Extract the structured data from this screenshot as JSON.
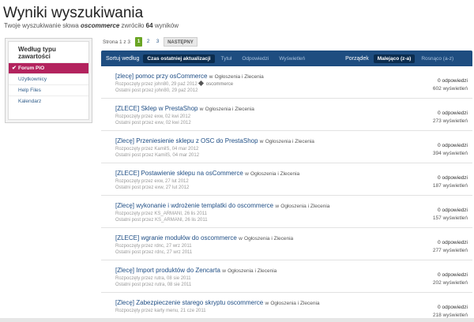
{
  "page": {
    "title": "Wyniki wyszukiwania",
    "subtitle_prefix": "Twoje wyszukiwanie słowa",
    "query": "oscommerce",
    "subtitle_mid": "zwróciło",
    "count": "64",
    "subtitle_suffix": "wyników"
  },
  "sidebar": {
    "title": "Według typu zawartości",
    "items": [
      {
        "label": "Forum PiO",
        "active": true
      },
      {
        "label": "Użytkownicy"
      },
      {
        "label": "Help Files"
      },
      {
        "label": "Kalendarz"
      }
    ]
  },
  "pagination": {
    "label": "Strona 1 z 3",
    "pages": [
      "1",
      "2",
      "3"
    ],
    "next": "NASTĘPNY"
  },
  "sortbar": {
    "sort_label": "Sortuj według",
    "options": [
      "Czas ostatniej aktualizacji",
      "Tytuł",
      "Odpowiedzi",
      "Wyświetleń"
    ],
    "order_label": "Porządek",
    "order_options": [
      "Malejąco (z-a)",
      "Rosnąco (a-z)"
    ]
  },
  "results": [
    {
      "title": "[zlecę] pomoc przy osCommerce",
      "in": "w",
      "forum": "Ogłoszenia i Zlecenia",
      "started": "Rozpoczęty przez john80, 29 paź 2012",
      "tag": "oscommerce",
      "last": "Ostatni post przez john80, 29 paź 2012",
      "replies": "0 odpowiedzi",
      "views": "602 wyświetleń"
    },
    {
      "title": "[ZLECE] Sklep w PrestaShop",
      "in": "w",
      "forum": "Ogłoszenia i Zlecenia",
      "started": "Rozpoczęty przez exw, 02 kwi 2012",
      "tag": "",
      "last": "Ostatni post przez exw, 02 kwi 2012",
      "replies": "0 odpowiedzi",
      "views": "273 wyświetleń"
    },
    {
      "title": "[Zlecę] Przeniesienie sklepu z OSC do PrestaShop",
      "in": "w",
      "forum": "Ogłoszenia i Zlecenia",
      "started": "Rozpoczęty przez KamilS, 04 mar 2012",
      "tag": "",
      "last": "Ostatni post przez KamilS, 04 mar 2012",
      "replies": "0 odpowiedzi",
      "views": "394 wyświetleń"
    },
    {
      "title": "[ZLECE] Postawienie sklepu na osCommerce",
      "in": "w",
      "forum": "Ogłoszenia i Zlecenia",
      "started": "Rozpoczęty przez exw, 27 lut 2012",
      "tag": "",
      "last": "Ostatni post przez exw, 27 lut 2012",
      "replies": "0 odpowiedzi",
      "views": "187 wyświetleń"
    },
    {
      "title": "[Zlecę] wykonanie i wdrożenie templatki do oscommerce",
      "in": "w",
      "forum": "Ogłoszenia i Zlecenia",
      "started": "Rozpoczęty przez KS_ARMANI, 26 lis 2011",
      "tag": "",
      "last": "Ostatni post przez KS_ARMANI, 26 lis 2011",
      "replies": "0 odpowiedzi",
      "views": "157 wyświetleń"
    },
    {
      "title": "[ZLECE] wgranie modułów do oscommerce",
      "in": "w",
      "forum": "Ogłoszenia i Zlecenia",
      "started": "Rozpoczęty przez rdnc, 27 wrz 2011",
      "tag": "",
      "last": "Ostatni post przez rdnc, 27 wrz 2011",
      "replies": "0 odpowiedzi",
      "views": "277 wyświetleń"
    },
    {
      "title": "[Zlecę] Import produktów do Zencarta",
      "in": "w",
      "forum": "Ogłoszenia i Zlecenia",
      "started": "Rozpoczęty przez rutra, 08 sie 2011",
      "tag": "",
      "last": "Ostatni post przez rutra, 08 sie 2011",
      "replies": "0 odpowiedzi",
      "views": "202 wyświetleń"
    },
    {
      "title": "[Zlecę] Zabezpieczenie starego skryptu oscommerce",
      "in": "w",
      "forum": "Ogłoszenia i Zlecenia",
      "started": "Rozpoczęty przez karty menu, 21 cze 2011",
      "tag": "",
      "last": "",
      "replies": "0 odpowiedzi",
      "views": "218 wyświetleń"
    }
  ]
}
